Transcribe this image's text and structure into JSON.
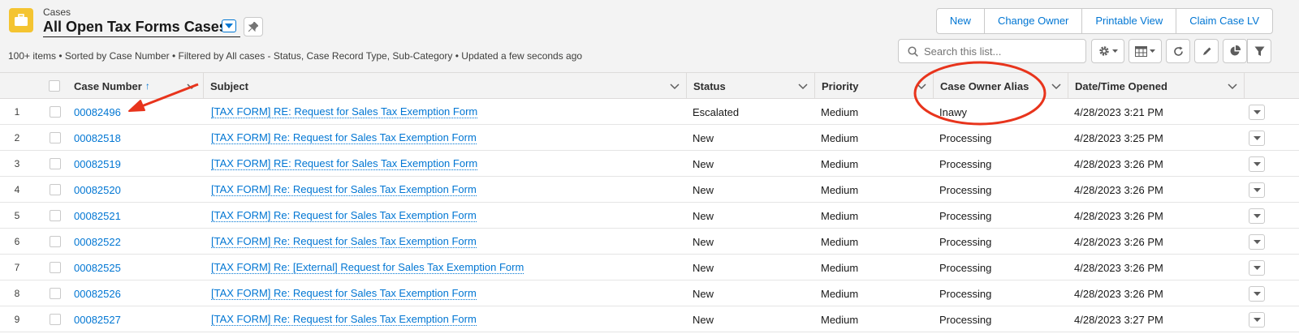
{
  "header": {
    "object_label": "Cases",
    "list_view_title": "All Open Tax Forms Cases",
    "meta": "100+ items • Sorted by Case Number • Filtered by All cases - Status, Case Record Type, Sub-Category • Updated a few seconds ago",
    "icon_color": "#f4c431"
  },
  "actions": {
    "buttons": [
      "New",
      "Change Owner",
      "Printable View",
      "Claim Case LV"
    ]
  },
  "search": {
    "placeholder": "Search this list..."
  },
  "toolbar": {
    "icons": [
      "gear-icon",
      "table-icon",
      "refresh-icon",
      "pencil-icon",
      "chart-icon",
      "filter-icon"
    ]
  },
  "table": {
    "columns": {
      "case_number": "Case Number",
      "subject": "Subject",
      "status": "Status",
      "priority": "Priority",
      "owner_alias": "Case Owner Alias",
      "opened": "Date/Time Opened"
    },
    "sort_indicator": "↑",
    "rows": [
      {
        "num": "1",
        "case_number": "00082496",
        "subject": "[TAX FORM] RE: Request for Sales Tax Exemption Form",
        "status": "Escalated",
        "priority": "Medium",
        "owner_alias": "Inawy",
        "opened": "4/28/2023 3:21 PM"
      },
      {
        "num": "2",
        "case_number": "00082518",
        "subject": "[TAX FORM] Re: Request for Sales Tax Exemption Form",
        "status": "New",
        "priority": "Medium",
        "owner_alias": "Processing",
        "opened": "4/28/2023 3:25 PM"
      },
      {
        "num": "3",
        "case_number": "00082519",
        "subject": "[TAX FORM] RE: Request for Sales Tax Exemption Form",
        "status": "New",
        "priority": "Medium",
        "owner_alias": "Processing",
        "opened": "4/28/2023 3:26 PM"
      },
      {
        "num": "4",
        "case_number": "00082520",
        "subject": "[TAX FORM] Re: Request for Sales Tax Exemption Form",
        "status": "New",
        "priority": "Medium",
        "owner_alias": "Processing",
        "opened": "4/28/2023 3:26 PM"
      },
      {
        "num": "5",
        "case_number": "00082521",
        "subject": "[TAX FORM] Re: Request for Sales Tax Exemption Form",
        "status": "New",
        "priority": "Medium",
        "owner_alias": "Processing",
        "opened": "4/28/2023 3:26 PM"
      },
      {
        "num": "6",
        "case_number": "00082522",
        "subject": "[TAX FORM] Re: Request for Sales Tax Exemption Form",
        "status": "New",
        "priority": "Medium",
        "owner_alias": "Processing",
        "opened": "4/28/2023 3:26 PM"
      },
      {
        "num": "7",
        "case_number": "00082525",
        "subject": "[TAX FORM] Re: [External] Request for Sales Tax Exemption Form",
        "status": "New",
        "priority": "Medium",
        "owner_alias": "Processing",
        "opened": "4/28/2023 3:26 PM"
      },
      {
        "num": "8",
        "case_number": "00082526",
        "subject": "[TAX FORM] Re: Request for Sales Tax Exemption Form",
        "status": "New",
        "priority": "Medium",
        "owner_alias": "Processing",
        "opened": "4/28/2023 3:26 PM"
      },
      {
        "num": "9",
        "case_number": "00082527",
        "subject": "[TAX FORM] Re: Request for Sales Tax Exemption Form",
        "status": "New",
        "priority": "Medium",
        "owner_alias": "Processing",
        "opened": "4/28/2023 3:27 PM"
      }
    ]
  },
  "annotations": {
    "color": "#e8341c",
    "shapes": [
      "red-arrow",
      "red-circle"
    ]
  }
}
